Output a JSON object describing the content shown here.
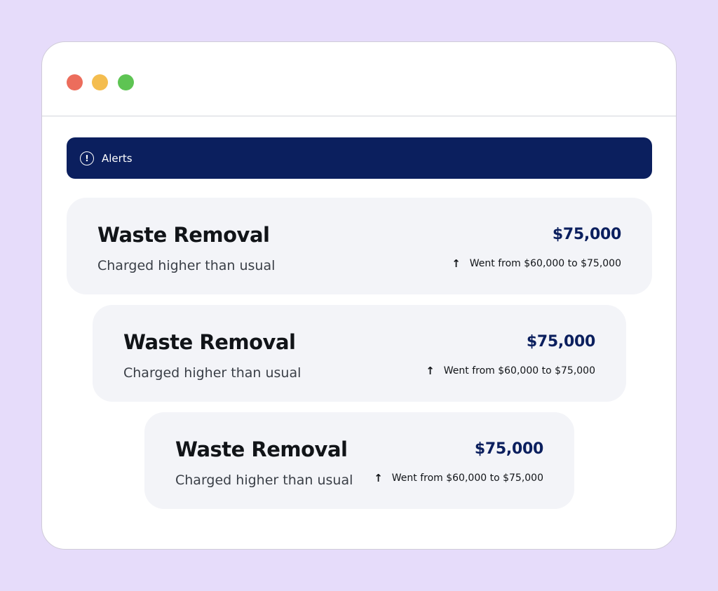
{
  "colors": {
    "background": "#e6dcfa",
    "window": "#ffffff",
    "alerts_bar": "#0b1f5e",
    "card_background": "#f3f4f8",
    "title_text": "#111418",
    "subtitle_text": "#3a3f47",
    "amount_text": "#0b1f5e",
    "traffic_red": "#ec6d5c",
    "traffic_yellow": "#f4bd4f",
    "traffic_green": "#5ec453"
  },
  "window": {
    "controls": [
      "close",
      "minimize",
      "maximize"
    ]
  },
  "alerts": {
    "icon": "alert-circle-icon",
    "label": "Alerts"
  },
  "cards": [
    {
      "title": "Waste Removal",
      "subtitle": "Charged higher than usual",
      "amount": "$75,000",
      "change_icon": "arrow-up-icon",
      "change_arrow": "↑",
      "change_text": "Went from $60,000 to $75,000"
    },
    {
      "title": "Waste Removal",
      "subtitle": "Charged higher than usual",
      "amount": "$75,000",
      "change_icon": "arrow-up-icon",
      "change_arrow": "↑",
      "change_text": "Went from $60,000 to $75,000"
    },
    {
      "title": "Waste Removal",
      "subtitle": "Charged higher than usual",
      "amount": "$75,000",
      "change_icon": "arrow-up-icon",
      "change_arrow": "↑",
      "change_text": "Went from $60,000 to $75,000"
    }
  ]
}
